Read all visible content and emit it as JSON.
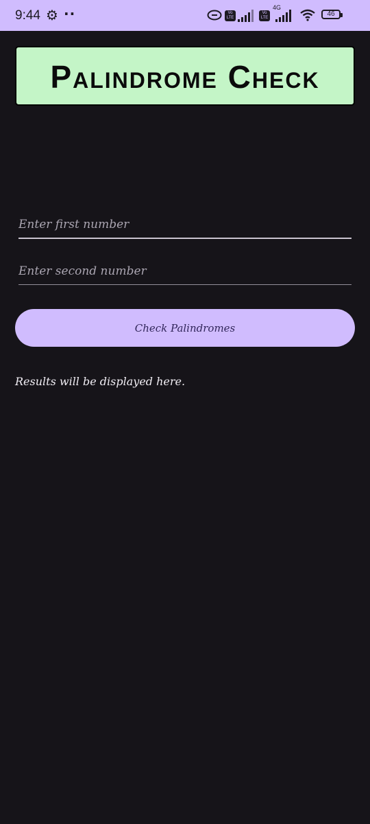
{
  "status_bar": {
    "time": "9:44",
    "notification_dots": "··",
    "icons": [
      "link-icon",
      "volte-icon",
      "signal-icon",
      "volte-icon",
      "signal-4g-icon",
      "wifi-icon",
      "battery-icon"
    ],
    "volte_label": "Vo LTE",
    "network_type": "4G",
    "battery_level": "46"
  },
  "app": {
    "title": "Palindrome Check",
    "first_input_placeholder": "Enter first number",
    "second_input_placeholder": "Enter second number",
    "check_button_label": "Check Palindromes",
    "results_text": "Results will be displayed here."
  },
  "colors": {
    "status_bar_bg": "#d0bcfe",
    "background": "#161419",
    "title_card_bg": "#c4f5c7",
    "button_bg": "#d0bcfe",
    "button_text": "#31265a"
  }
}
